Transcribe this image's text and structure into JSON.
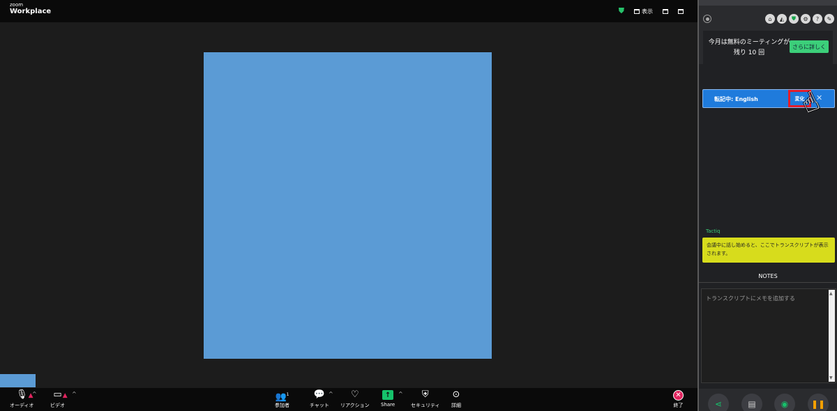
{
  "zoom": {
    "logo_small": "zoom",
    "logo_big": "Workplace",
    "view_label": "表示",
    "toolbar": {
      "audio": "オーディオ",
      "video": "ビデオ",
      "participants": "参加者",
      "participants_count": "1",
      "chat": "チャット",
      "reactions": "リアクション",
      "share": "Share",
      "security": "セキュリティ",
      "more": "詳細",
      "end": "終了"
    }
  },
  "tactiq": {
    "free_meetings_text": "今月は無料のミーティングが残り 10 回",
    "learn_more": "さらに詳しく",
    "transcribing": "転記中: English",
    "change": "変化",
    "brand": "Tactiq",
    "hint": "会議中に話し始めると、ここでトランスクリプトが表示されます。",
    "notes_header": "NOTES",
    "notes_placeholder": "トランスクリプトにメモを追加する"
  },
  "colors": {
    "share_bg": "#16c26b",
    "end_red": "#e0245e",
    "stage_blue": "#5b9bd5",
    "tactiq_green": "#3ccf7a",
    "tactiq_yellow": "#d7dc1c",
    "transcribe_blue": "#1f7bdc",
    "highlight_red": "#e11d2b"
  },
  "icons": {
    "header": [
      "home-icon",
      "eraser-icon",
      "shield-icon",
      "gear-icon",
      "help-icon",
      "pin-icon"
    ],
    "footer": [
      "share-icon",
      "document-icon",
      "camera-icon",
      "pause-icon"
    ]
  }
}
